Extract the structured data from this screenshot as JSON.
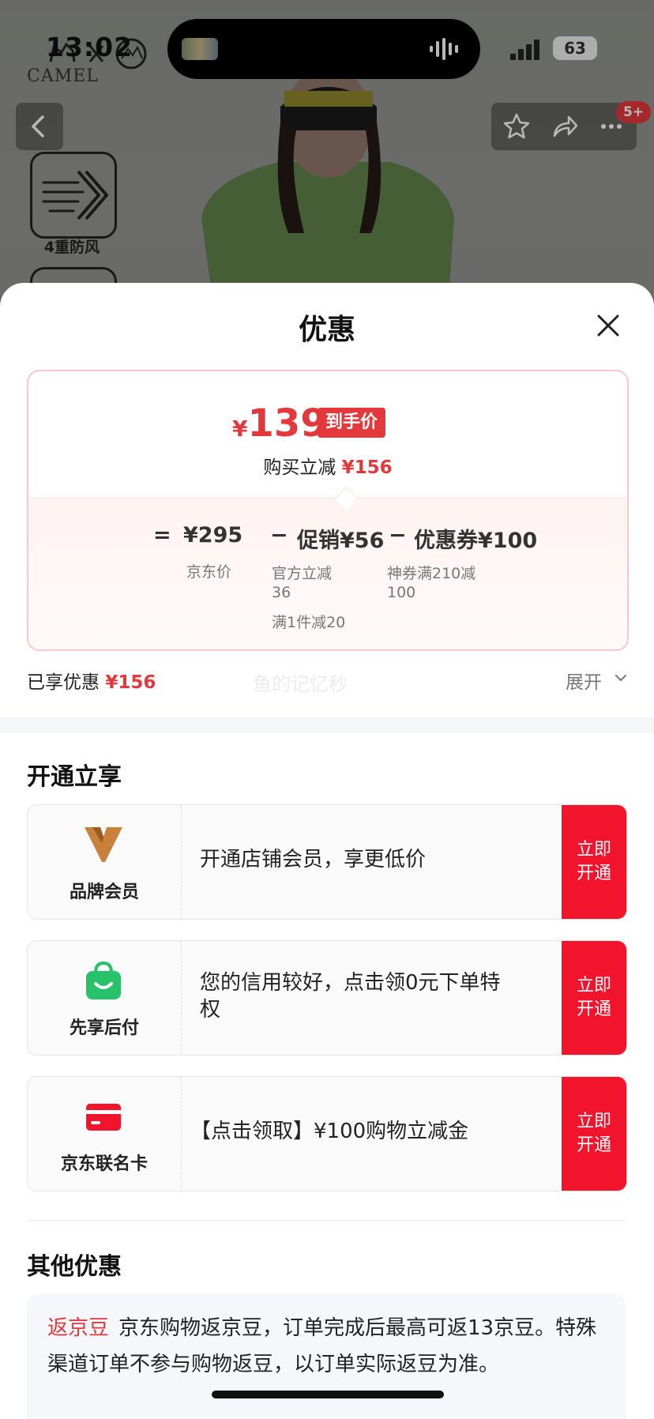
{
  "status_bar": {
    "time": "13:02",
    "battery": "63"
  },
  "background": {
    "brand_name": "CAMEL",
    "feature_label": "4重防风",
    "cart_badge": "5+"
  },
  "sheet": {
    "title": "优惠",
    "price_card": {
      "currency": "¥",
      "final_price": "139",
      "final_tag": "到手价",
      "reduce_label": "购买立减",
      "reduce_amount": "¥156",
      "eq_sign": "=",
      "minus_sign": "−",
      "base_price": "¥295",
      "base_label": "京东价",
      "promo": "促销¥56",
      "promo_line1": "官方立减",
      "promo_line2": "36",
      "promo_line3": "满1件减20",
      "coupon": "优惠券¥100",
      "coupon_line1": "神券满210减",
      "coupon_line2": "100"
    },
    "enjoyed_label": "已享优惠",
    "enjoyed_amount": "¥156",
    "watermark": "鱼的记忆秒",
    "expand_label": "展开",
    "open_section_title": "开通立享",
    "offers": [
      {
        "label": "品牌会员",
        "text": "开通店铺会员，享更低价",
        "button": "立即开通",
        "icon": "brand-member-icon"
      },
      {
        "label": "先享后付",
        "text": "您的信用较好，点击领0元下单特权",
        "button": "立即开通",
        "icon": "pay-later-bag-icon"
      },
      {
        "label": "京东联名卡",
        "text": "【点击领取】¥100购物立减金",
        "button": "立即开通",
        "icon": "co-brand-card-icon"
      }
    ],
    "other_section_title": "其他优惠",
    "other": {
      "tag": "返京豆",
      "text": "京东购物返京豆，订单完成后最高可返13京豆。特殊渠道订单不参与购物返豆，以订单实际返豆为准。"
    }
  },
  "colors": {
    "accent_red": "#e4393c",
    "button_red": "#f2142d",
    "green": "#27c26a"
  }
}
